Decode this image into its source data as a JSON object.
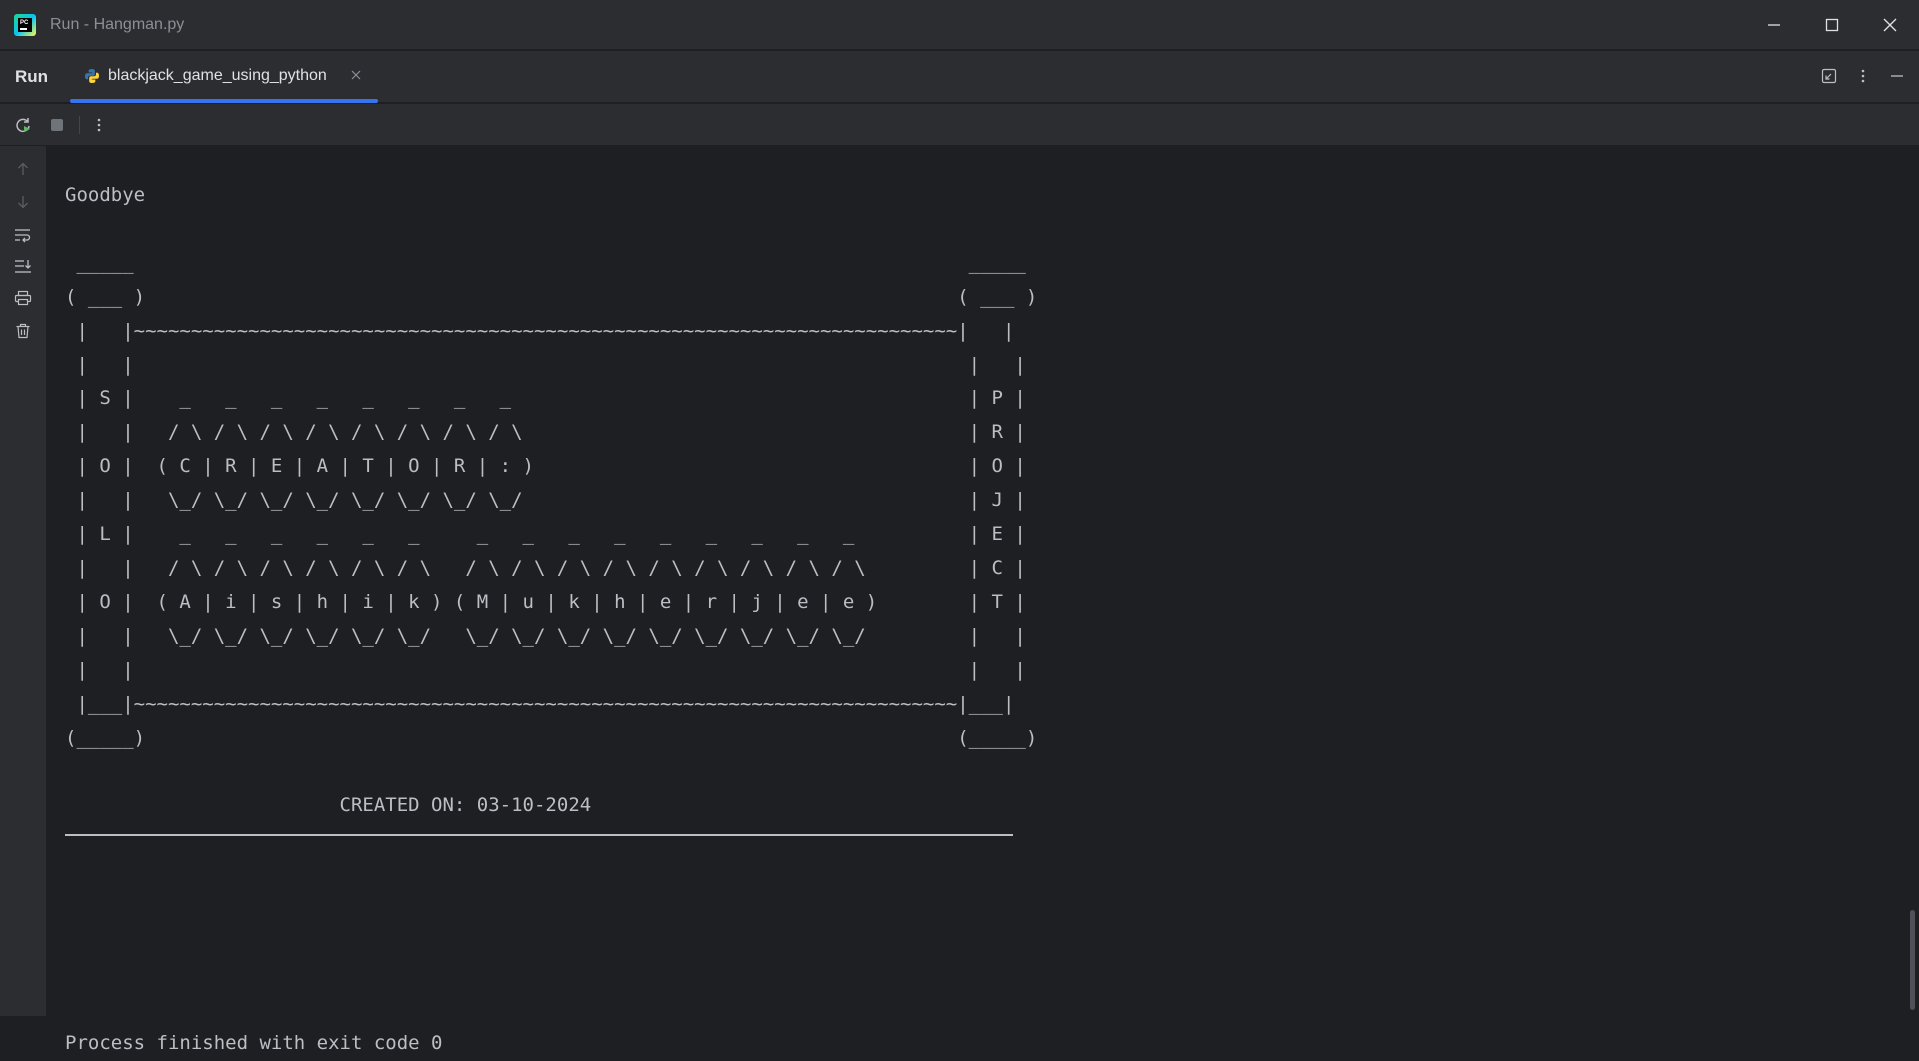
{
  "window": {
    "title": "Run - Hangman.py"
  },
  "run_panel": {
    "tool_window_title": "Run",
    "tab": {
      "label": "blackjack_game_using_python"
    }
  },
  "console": {
    "goodbye": "Goodbye",
    "ascii_art": [
      " _____                                                                         _____",
      "( ___ )                                                                       ( ___ )",
      " |   |~~~~~~~~~~~~~~~~~~~~~~~~~~~~~~~~~~~~~~~~~~~~~~~~~~~~~~~~~~~~~~~~~~~~~~~~|   |",
      " |   |                                                                         |   |",
      " | S |    _   _   _   _   _   _   _   _                                        | P |",
      " |   |   / \\ / \\ / \\ / \\ / \\ / \\ / \\ / \\                                       | R |",
      " | O |  ( C | R | E | A | T | O | R | : )                                      | O |",
      " |   |   \\_/ \\_/ \\_/ \\_/ \\_/ \\_/ \\_/ \\_/                                       | J |",
      " | L |    _   _   _   _   _   _     _   _   _   _   _   _   _   _   _          | E |",
      " |   |   / \\ / \\ / \\ / \\ / \\ / \\   / \\ / \\ / \\ / \\ / \\ / \\ / \\ / \\ / \\         | C |",
      " | O |  ( A | i | s | h | i | k ) ( M | u | k | h | e | r | j | e | e )        | T |",
      " |   |   \\_/ \\_/ \\_/ \\_/ \\_/ \\_/   \\_/ \\_/ \\_/ \\_/ \\_/ \\_/ \\_/ \\_/ \\_/         |   |",
      " |   |                                                                         |   |",
      " |___|~~~~~~~~~~~~~~~~~~~~~~~~~~~~~~~~~~~~~~~~~~~~~~~~~~~~~~~~~~~~~~~~~~~~~~~~|___|",
      "(_____)                                                                       (_____)"
    ],
    "created_on": "                        CREATED ON: 03-10-2024",
    "process_finished": "Process finished with exit code 0"
  },
  "colors": {
    "background": "#1e1f22",
    "panel": "#2b2d30",
    "text": "#bcbec4",
    "tab_accent": "#3574f0",
    "rerun_green": "#5fb865"
  },
  "icons": {
    "titlebar": [
      "pycharm-logo-icon",
      "minimize-icon",
      "maximize-icon",
      "close-icon"
    ],
    "tabbar": [
      "python-file-icon",
      "close-tab-icon",
      "restore-layout-icon",
      "more-options-icon",
      "hide-panel-icon"
    ],
    "toolbar": [
      "rerun-icon",
      "stop-icon",
      "more-vertical-icon"
    ],
    "gutter": [
      "arrow-up-icon",
      "arrow-down-icon",
      "soft-wrap-icon",
      "scroll-to-end-icon",
      "print-icon",
      "trash-icon"
    ]
  }
}
